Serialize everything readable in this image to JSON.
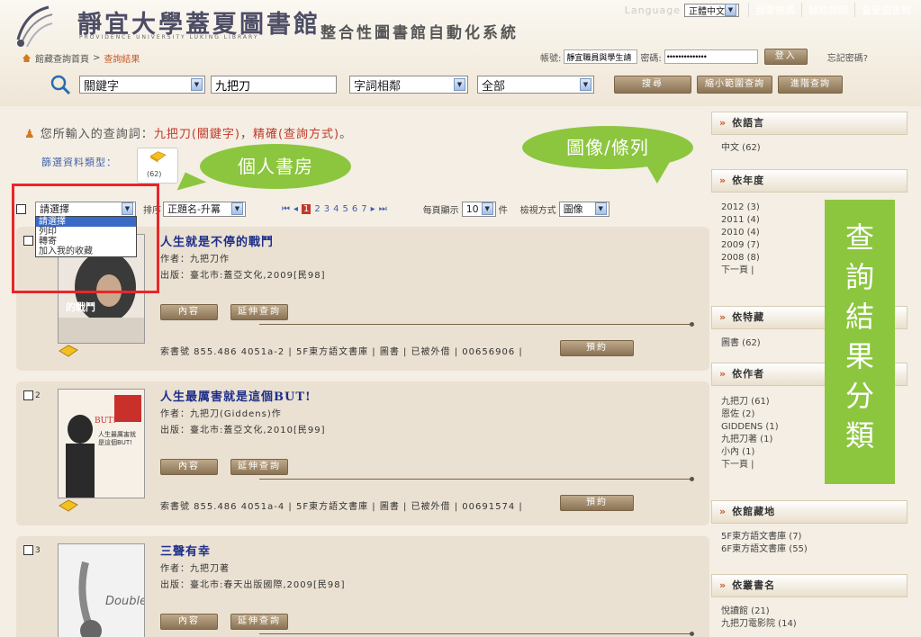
{
  "header": {
    "title": "靜宜大學蓋夏圖書館",
    "title_en": "PROVIDENCE UNIVERSITY LUKING LIBRARY",
    "system_name": "整合性圖書館自動化系統",
    "language_label": "Language",
    "language_value": "正體中文",
    "links": [
      "我要推薦",
      "輔助說明",
      "蓋夏圖書館"
    ],
    "breadcrumb_home": "館藏查詢首頁",
    "breadcrumb_sep": ">",
    "breadcrumb_current": "查詢結果",
    "account_label": "帳號:",
    "account_value": "靜宜職員與學生請",
    "password_label": "密碼:",
    "password_value": "••••••••••••••",
    "login_button": "登入",
    "forgot_link": "忘記密碼?"
  },
  "search": {
    "field": "關鍵字",
    "keyword": "九把刀",
    "mode": "字詞相鄰",
    "scope": "全部",
    "search_button": "搜尋",
    "narrow_button": "縮小範圍查詢",
    "advanced_button": "進階查詢"
  },
  "query": {
    "prefix": "您所輸入的查詢詞：",
    "term": "九把刀(關鍵字)",
    "comma": "，",
    "method": "精確(查詢方式)",
    "suffix": "。",
    "filter_label": "篩選資料類型：",
    "type_count": "(62)"
  },
  "callouts": {
    "personal_shelf": "個人書房",
    "image_list": "圖像/條列",
    "facets": [
      "查",
      "詢",
      "結",
      "果",
      "分",
      "類"
    ]
  },
  "toolbar": {
    "action_select": "請選擇",
    "action_options": [
      "請選擇",
      "列印",
      "轉寄",
      "加入我的收藏"
    ],
    "sort_label": "排序",
    "sort_value": "正題名-升冪",
    "pages": [
      "1",
      "2",
      "3",
      "4",
      "5",
      "6",
      "7"
    ],
    "current_page": "1",
    "per_page_label": "每頁顯示",
    "per_page_value": "10",
    "per_page_unit": "件",
    "view_label": "檢視方式",
    "view_value": "圖像"
  },
  "results": [
    {
      "num": "",
      "title": "人生就是不停的戰鬥",
      "author": "作者：九把刀作",
      "publish": "出版：臺北市:蓋亞文化,2009[民98]",
      "btn_content": "內容",
      "btn_extend": "延伸查詢",
      "callno": "索書號 855.486 4051a-2 | 5F東方語文書庫 | 圖書 | 已被外借 | 00656906 |",
      "reserve": "預約"
    },
    {
      "num": "2",
      "title": "人生最厲害就是這個BUT!",
      "author": "作者：九把刀(Giddens)作",
      "publish": "出版：臺北市:蓋亞文化,2010[民99]",
      "btn_content": "內容",
      "btn_extend": "延伸查詢",
      "callno": "索書號 855.486 4051a-4 | 5F東方語文書庫 | 圖書 | 已被外借 | 00691574 |",
      "reserve": "預約"
    },
    {
      "num": "3",
      "title": "三聲有幸",
      "author": "作者：九把刀著",
      "publish": "出版：臺北市:春天出版國際,2009[民98]",
      "btn_content": "內容",
      "btn_extend": "延伸查詢",
      "callno": "",
      "reserve": ""
    }
  ],
  "covers": {
    "c1_text": "的戰鬥",
    "c2_text_a": "BUT!",
    "c2_text_b": "人生最厲害就是這個BUT!",
    "c3_text": "Doubles"
  },
  "facets": {
    "lang_title": "依語言",
    "lang_items": [
      "中文 (62)"
    ],
    "year_title": "依年度",
    "year_items": [
      "2012 (3)",
      "2011 (4)",
      "2010 (4)",
      "2009 (7)",
      "2008 (8)",
      "下一頁 |"
    ],
    "special_title": "依特藏",
    "special_items": [
      "圖書 (62)"
    ],
    "author_title": "依作者",
    "author_items": [
      "九把刀 (61)",
      "恩佐 (2)",
      "GIDDENS (1)",
      "九把刀著 (1)",
      "小內 (1)",
      "下一頁 |"
    ],
    "location_title": "依館藏地",
    "location_items": [
      "5F東方語文書庫 (7)",
      "6F東方語文書庫 (55)"
    ],
    "series_title": "依叢書名",
    "series_items": [
      "悅讀館 (21)",
      "九把刀電影院 (14)"
    ]
  },
  "colors": {
    "accent_red": "#e8262a",
    "callout_green": "#8cc63f",
    "title_blue": "#1d2e8a"
  }
}
